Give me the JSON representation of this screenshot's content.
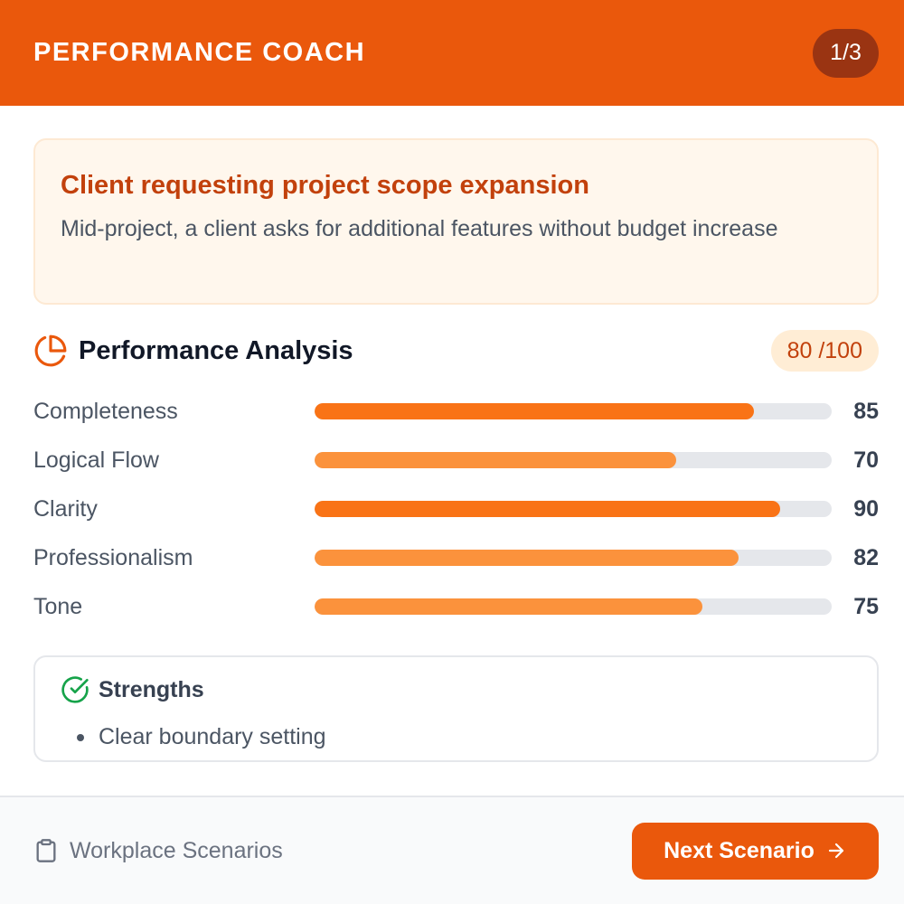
{
  "header": {
    "title": "PERFORMANCE COACH",
    "counter": "1/3"
  },
  "scenario": {
    "title": "Client requesting project scope expansion",
    "description": "Mid-project, a client asks for additional features without budget increase"
  },
  "analysis": {
    "title": "Performance Analysis",
    "icon": "pie-chart-icon",
    "score": "80",
    "score_suffix": " /100",
    "metrics": [
      {
        "label": "Completeness",
        "value": 85,
        "value_text": "85",
        "color": "#f97316"
      },
      {
        "label": "Logical Flow",
        "value": 70,
        "value_text": "70",
        "color": "#fb923c"
      },
      {
        "label": "Clarity",
        "value": 90,
        "value_text": "90",
        "color": "#f97316"
      },
      {
        "label": "Professionalism",
        "value": 82,
        "value_text": "82",
        "color": "#fb923c"
      },
      {
        "label": "Tone",
        "value": 75,
        "value_text": "75",
        "color": "#fb923c"
      }
    ]
  },
  "strengths": {
    "title": "Strengths",
    "icon": "check-circle-icon",
    "items": [
      "Clear boundary setting"
    ]
  },
  "footer": {
    "label": "Workplace Scenarios",
    "icon": "clipboard-icon",
    "next_label": "Next Scenario",
    "next_icon": "arrow-right-icon"
  },
  "colors": {
    "accent": "#ea580c",
    "accent_dark": "#9a3412",
    "success": "#16a34a"
  }
}
